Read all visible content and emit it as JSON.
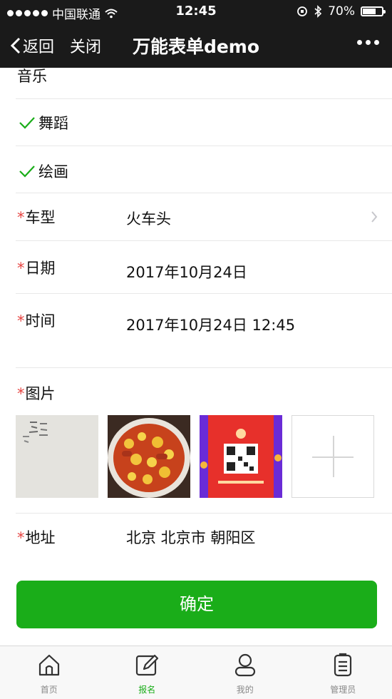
{
  "status_bar": {
    "carrier": "中国联通",
    "time": "12:45",
    "battery": "70%",
    "battery_level": 0.7,
    "icons": [
      "signal-dots-icon",
      "wifi-icon",
      "orientation-lock-icon",
      "bluetooth-icon",
      "battery-icon"
    ]
  },
  "nav": {
    "back_label": "返回",
    "close_label": "关闭",
    "title": "万能表单demo",
    "more_icon": "more-dots-icon"
  },
  "form": {
    "options": [
      {
        "label": "音乐",
        "checked": false
      },
      {
        "label": "舞蹈",
        "checked": true
      },
      {
        "label": "绘画",
        "checked": true
      }
    ],
    "car_type": {
      "label": "车型",
      "required": "*",
      "value": "火车头"
    },
    "date": {
      "label": "日期",
      "required": "*",
      "value": "2017年10月24日"
    },
    "time": {
      "label": "时间",
      "required": "*",
      "value": "2017年10月24日 12:45"
    },
    "images": {
      "label": "图片",
      "required": "*"
    },
    "address": {
      "label": "地址",
      "required": "*",
      "value": "北京 北京市 朝阳区"
    }
  },
  "confirm_label": "确定",
  "tabs": [
    {
      "label": "首页",
      "icon": "home-icon",
      "active": false
    },
    {
      "label": "报名",
      "icon": "edit-icon",
      "active": true
    },
    {
      "label": "我的",
      "icon": "user-icon",
      "active": false
    },
    {
      "label": "管理员",
      "icon": "clipboard-icon",
      "active": false
    }
  ],
  "colors": {
    "accent": "#1aad19",
    "required": "#e64340",
    "bar": "#1a1a1a"
  }
}
